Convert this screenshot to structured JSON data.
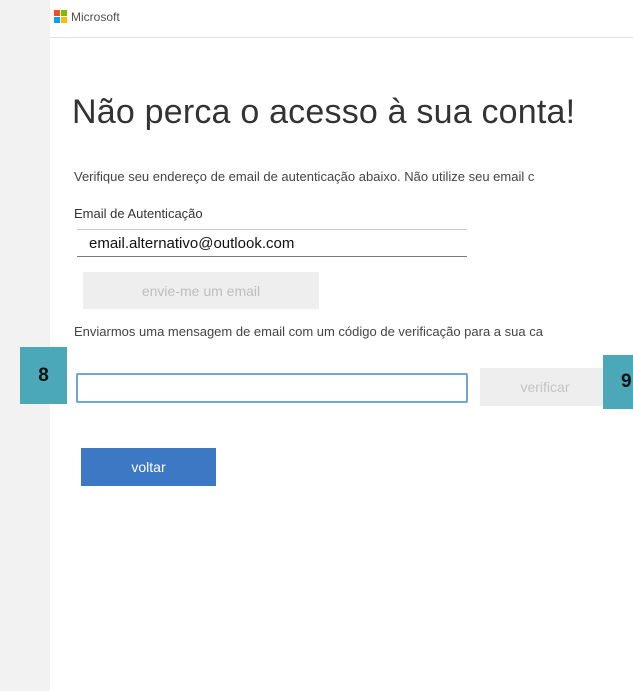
{
  "header": {
    "brand": "Microsoft"
  },
  "page": {
    "title": "Não perca o acesso à sua conta!",
    "description": "Verifique seu endereço de email de autenticação abaixo. Não utilize seu email c",
    "auth_email_label": "Email de Autenticação",
    "auth_email_value": "email.alternativo@outlook.com",
    "send_button_label": "envie-me um email",
    "sent_message": "Enviarmos uma mensagem de email com um código de verificação para a sua ca",
    "verification_code_value": "",
    "verify_button_label": "verificar",
    "back_button_label": "voltar"
  },
  "annotations": {
    "marker_8": "8",
    "marker_9": "9"
  },
  "colors": {
    "back_button": "#3c78c3",
    "code_input_border": "#6fa6d6",
    "annotation_marker": "#4aa8b8",
    "disabled_button": "#eeeeee"
  }
}
